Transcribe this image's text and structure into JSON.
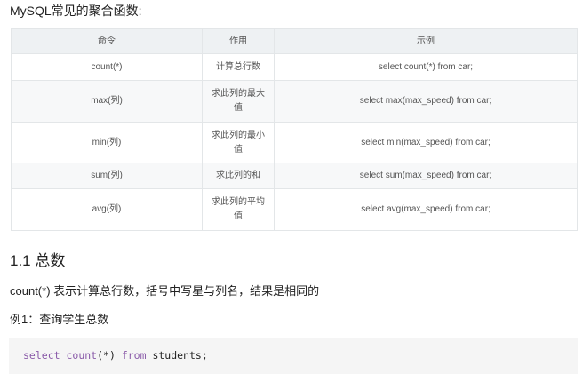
{
  "title": "MySQL常见的聚合函数:",
  "table": {
    "headers": [
      "命令",
      "作用",
      "示例"
    ],
    "rows": [
      [
        "count(*)",
        "计算总行数",
        "select count(*) from car;"
      ],
      [
        "max(列)",
        "求此列的最大值",
        "select max(max_speed) from car;"
      ],
      [
        "min(列)",
        "求此列的最小值",
        "select min(max_speed) from car;"
      ],
      [
        "sum(列)",
        "求此列的和",
        "select sum(max_speed) from car;"
      ],
      [
        "avg(列)",
        "求此列的平均值",
        "select avg(max_speed) from car;"
      ]
    ]
  },
  "section": {
    "heading": "1.1 总数",
    "paragraph": "count(*) 表示计算总行数，括号中写星与列名，结果是相同的",
    "example": "例1：查询学生总数"
  },
  "code": {
    "kw1": "select",
    "fn": "count",
    "args": "(*)",
    "kw2": "from",
    "rest": " students;"
  }
}
